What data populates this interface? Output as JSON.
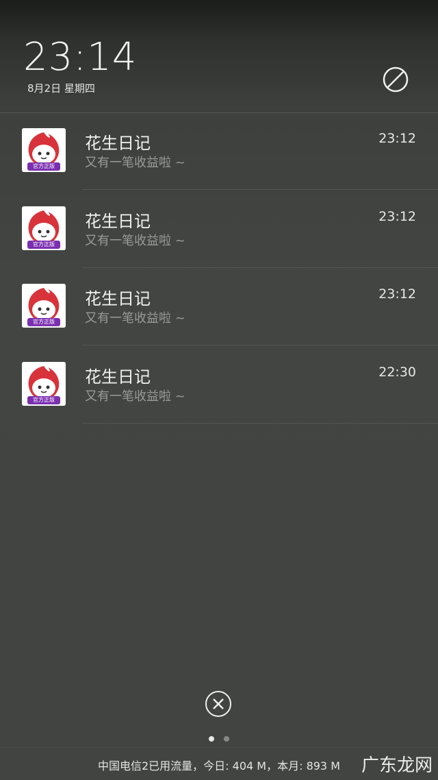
{
  "status": {
    "time": "23:14",
    "date": "8月2日 星期四"
  },
  "dnd_icon": "do-not-disturb-icon",
  "notifications": [
    {
      "app": "花生日记",
      "message": "又有一笔收益啦 ~",
      "time": "23:12",
      "badge": "官方正版"
    },
    {
      "app": "花生日记",
      "message": "又有一笔收益啦 ~",
      "time": "23:12",
      "badge": "官方正版"
    },
    {
      "app": "花生日记",
      "message": "又有一笔收益啦 ~",
      "time": "23:12",
      "badge": "官方正版"
    },
    {
      "app": "花生日记",
      "message": "又有一笔收益啦 ~",
      "time": "22:30",
      "badge": "官方正版"
    }
  ],
  "clear_icon": "close-circle-icon",
  "pager": {
    "pages": 2,
    "current": 1
  },
  "footer": {
    "data_usage": "中国电信2已用流量，今日: 404 M，本月: 893 M"
  },
  "watermark": "广东龙网"
}
